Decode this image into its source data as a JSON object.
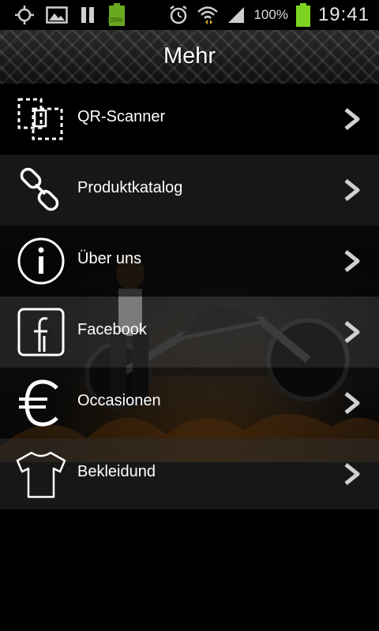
{
  "status_bar": {
    "battery_small_text": "100%",
    "battery_percent": "100%",
    "time": "19:41"
  },
  "header": {
    "title": "Mehr"
  },
  "menu": {
    "items": [
      {
        "label": "QR-Scanner",
        "icon": "qr-scanner-icon"
      },
      {
        "label": "Produktkatalog",
        "icon": "chain-link-icon"
      },
      {
        "label": "Über uns",
        "icon": "info-icon"
      },
      {
        "label": "Facebook",
        "icon": "facebook-icon"
      },
      {
        "label": "Occasionen",
        "icon": "euro-icon"
      },
      {
        "label": "Bekleidund",
        "icon": "tshirt-icon"
      }
    ]
  },
  "colors": {
    "accent_battery": "#7ed321",
    "background": "#000000",
    "chevron": "#d0d0d0"
  }
}
